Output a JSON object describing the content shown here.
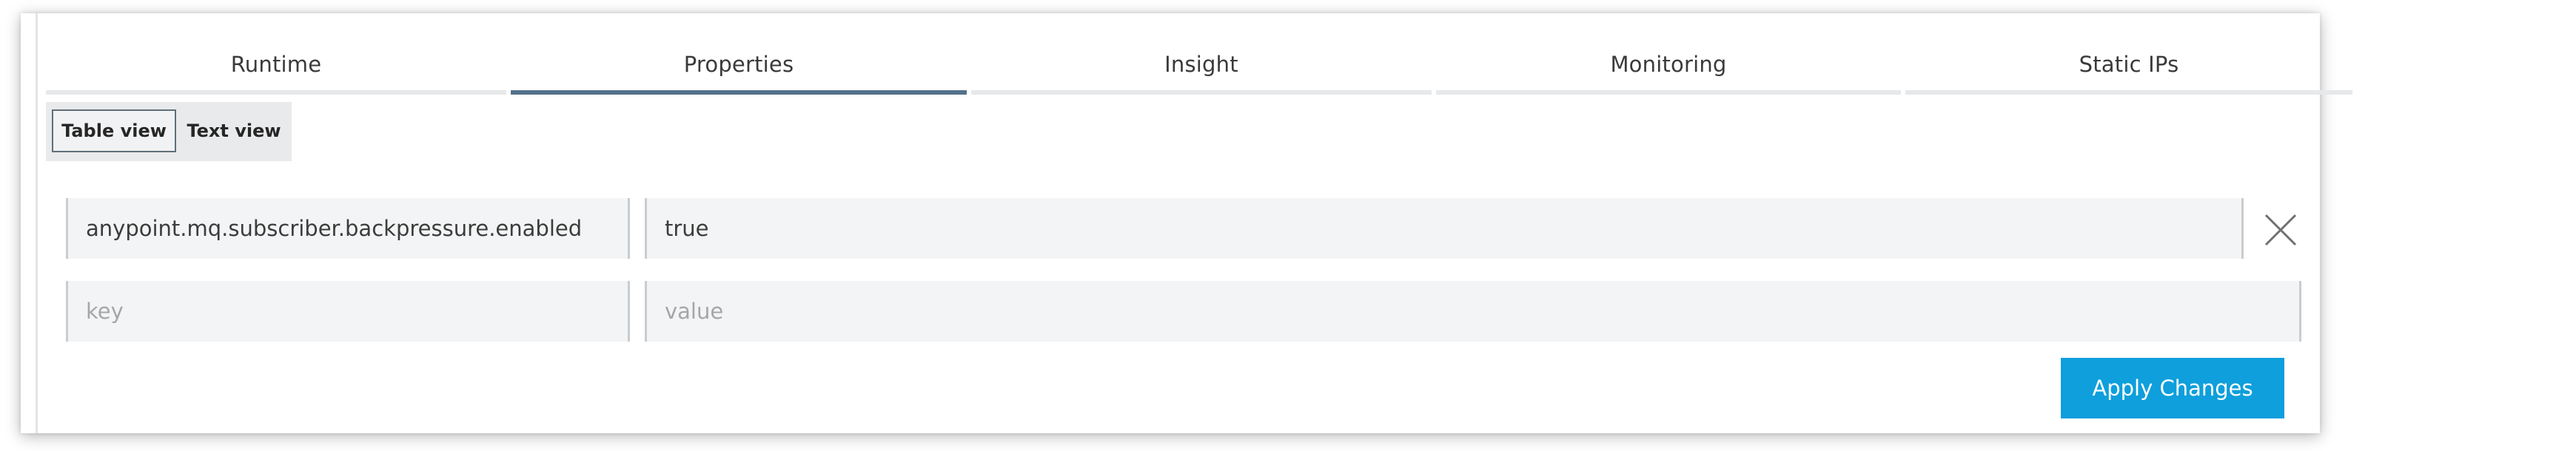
{
  "tabs": [
    {
      "label": "Runtime",
      "active": false
    },
    {
      "label": "Properties",
      "active": true
    },
    {
      "label": "Insight",
      "active": false
    },
    {
      "label": "Monitoring",
      "active": false
    },
    {
      "label": "Static IPs",
      "active": false
    }
  ],
  "view_toggle": {
    "table_label": "Table view",
    "text_label": "Text view",
    "selected": "Table view"
  },
  "properties": [
    {
      "key": "anypoint.mq.subscriber.backpressure.enabled",
      "value": "true"
    }
  ],
  "new_property": {
    "key_placeholder": "key",
    "value_placeholder": "value"
  },
  "actions": {
    "remove_icon": "close-x-icon",
    "apply_label": "Apply Changes"
  },
  "colors": {
    "accent_tab": "#53728d",
    "apply_button": "#0e9fdc"
  }
}
